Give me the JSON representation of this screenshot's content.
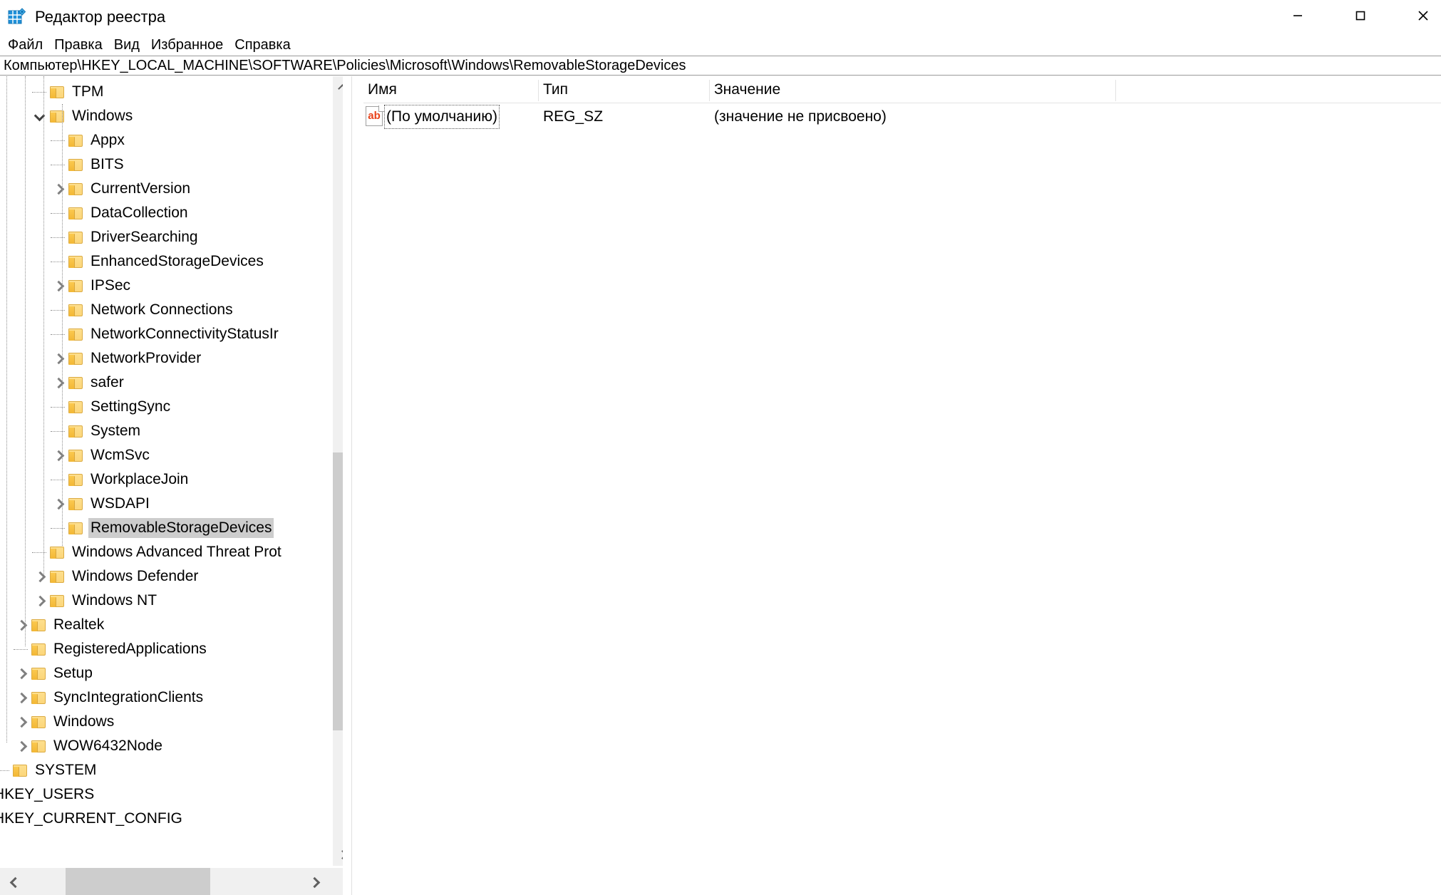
{
  "window": {
    "title": "Редактор реестра",
    "app_icon": "registry-editor-icon",
    "controls": {
      "minimize": "minimize-icon",
      "maximize": "maximize-icon",
      "close": "close-icon"
    }
  },
  "menubar": {
    "items": [
      {
        "label": "Файл"
      },
      {
        "label": "Правка"
      },
      {
        "label": "Вид"
      },
      {
        "label": "Избранное"
      },
      {
        "label": "Справка"
      }
    ]
  },
  "address": {
    "path": "Компьютер\\HKEY_LOCAL_MACHINE\\SOFTWARE\\Policies\\Microsoft\\Windows\\RemovableStorageDevices"
  },
  "tree": {
    "rows": [
      {
        "label": "TPM",
        "depth": 3,
        "twisty": "none",
        "folder": true,
        "selected": false
      },
      {
        "label": "Windows",
        "depth": 3,
        "twisty": "down",
        "folder": true,
        "selected": false
      },
      {
        "label": "Appx",
        "depth": 4,
        "twisty": "none",
        "folder": true,
        "selected": false
      },
      {
        "label": "BITS",
        "depth": 4,
        "twisty": "none",
        "folder": true,
        "selected": false
      },
      {
        "label": "CurrentVersion",
        "depth": 4,
        "twisty": "right",
        "folder": true,
        "selected": false
      },
      {
        "label": "DataCollection",
        "depth": 4,
        "twisty": "none",
        "folder": true,
        "selected": false
      },
      {
        "label": "DriverSearching",
        "depth": 4,
        "twisty": "none",
        "folder": true,
        "selected": false
      },
      {
        "label": "EnhancedStorageDevices",
        "depth": 4,
        "twisty": "none",
        "folder": true,
        "selected": false
      },
      {
        "label": "IPSec",
        "depth": 4,
        "twisty": "right",
        "folder": true,
        "selected": false
      },
      {
        "label": "Network Connections",
        "depth": 4,
        "twisty": "none",
        "folder": true,
        "selected": false
      },
      {
        "label": "NetworkConnectivityStatusIr",
        "depth": 4,
        "twisty": "none",
        "folder": true,
        "selected": false
      },
      {
        "label": "NetworkProvider",
        "depth": 4,
        "twisty": "right",
        "folder": true,
        "selected": false
      },
      {
        "label": "safer",
        "depth": 4,
        "twisty": "right",
        "folder": true,
        "selected": false
      },
      {
        "label": "SettingSync",
        "depth": 4,
        "twisty": "none",
        "folder": true,
        "selected": false
      },
      {
        "label": "System",
        "depth": 4,
        "twisty": "none",
        "folder": true,
        "selected": false
      },
      {
        "label": "WcmSvc",
        "depth": 4,
        "twisty": "right",
        "folder": true,
        "selected": false
      },
      {
        "label": "WorkplaceJoin",
        "depth": 4,
        "twisty": "none",
        "folder": true,
        "selected": false
      },
      {
        "label": "WSDAPI",
        "depth": 4,
        "twisty": "right",
        "folder": true,
        "selected": false
      },
      {
        "label": "RemovableStorageDevices",
        "depth": 4,
        "twisty": "none",
        "folder": true,
        "selected": true
      },
      {
        "label": "Windows Advanced Threat Prot",
        "depth": 3,
        "twisty": "none",
        "folder": true,
        "selected": false
      },
      {
        "label": "Windows Defender",
        "depth": 3,
        "twisty": "right",
        "folder": true,
        "selected": false
      },
      {
        "label": "Windows NT",
        "depth": 3,
        "twisty": "right",
        "folder": true,
        "selected": false
      },
      {
        "label": "Realtek",
        "depth": 2,
        "twisty": "right",
        "folder": true,
        "selected": false
      },
      {
        "label": "RegisteredApplications",
        "depth": 2,
        "twisty": "none",
        "folder": true,
        "selected": false
      },
      {
        "label": "Setup",
        "depth": 2,
        "twisty": "right",
        "folder": true,
        "selected": false
      },
      {
        "label": "SyncIntegrationClients",
        "depth": 2,
        "twisty": "right",
        "folder": true,
        "selected": false
      },
      {
        "label": "Windows",
        "depth": 2,
        "twisty": "right",
        "folder": true,
        "selected": false
      },
      {
        "label": "WOW6432Node",
        "depth": 2,
        "twisty": "right",
        "folder": true,
        "selected": false
      },
      {
        "label": "SYSTEM",
        "depth": 1,
        "twisty": "none",
        "folder": true,
        "selected": false
      },
      {
        "label": "HKEY_USERS",
        "depth": 0,
        "twisty": "none",
        "folder": false,
        "selected": false
      },
      {
        "label": "HKEY_CURRENT_CONFIG",
        "depth": 0,
        "twisty": "none",
        "folder": false,
        "selected": false
      }
    ]
  },
  "list": {
    "columns": [
      {
        "label": "Имя"
      },
      {
        "label": "Тип"
      },
      {
        "label": "Значение"
      }
    ],
    "rows": [
      {
        "icon": "string-value-icon",
        "name": "(По умолчанию)",
        "type": "REG_SZ",
        "value": "(значение не присвоено)"
      }
    ]
  },
  "scrollbars": {
    "tree_vertical": {
      "up": "chevron-up-icon",
      "down": "chevron-down-icon"
    },
    "tree_horizontal": {
      "left": "chevron-left-icon",
      "right": "chevron-right-icon"
    }
  },
  "colors": {
    "selection": "#cdcdcd",
    "folder": "#fcd67a",
    "accent": "#e8421a",
    "scrollbar_track": "#f0f0f0",
    "scrollbar_thumb": "#cdcdcd"
  }
}
